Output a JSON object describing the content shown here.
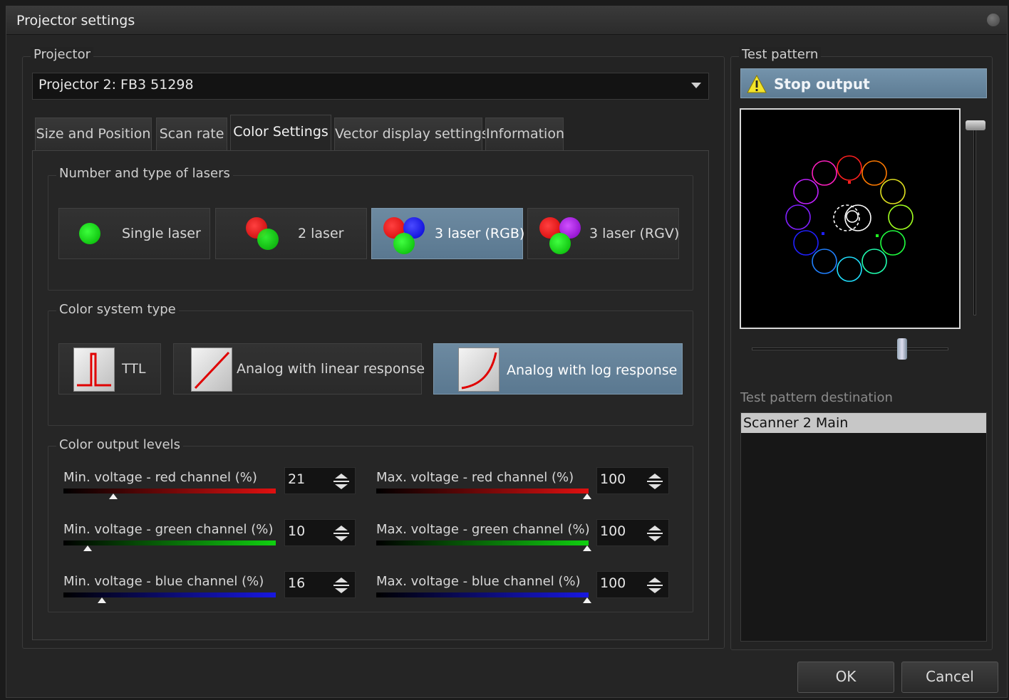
{
  "window": {
    "title": "Projector settings"
  },
  "projector": {
    "group_label": "Projector",
    "selected": "Projector 2: FB3 51298"
  },
  "tabs": [
    {
      "label": "Size and Position"
    },
    {
      "label": "Scan rate"
    },
    {
      "label": "Color Settings"
    },
    {
      "label": "Vector display settings"
    },
    {
      "label": "Information"
    }
  ],
  "active_tab": "Color Settings",
  "lasers": {
    "group_label": "Number and type of lasers",
    "options": [
      {
        "label": "Single laser"
      },
      {
        "label": "2 laser"
      },
      {
        "label": "3 laser (RGB)"
      },
      {
        "label": "3 laser (RGV)"
      }
    ],
    "selected": "3 laser (RGB)"
  },
  "color_system": {
    "group_label": "Color system type",
    "options": [
      {
        "label": "TTL"
      },
      {
        "label": "Analog with linear response"
      },
      {
        "label": "Analog with log response"
      }
    ],
    "selected": "Analog with log response"
  },
  "levels": {
    "group_label": "Color output levels",
    "min": [
      {
        "label": "Min. voltage - red channel (%)",
        "value": "21",
        "color": "#e01010"
      },
      {
        "label": "Min. voltage - green channel (%)",
        "value": "10",
        "color": "#10d010"
      },
      {
        "label": "Min. voltage - blue channel (%)",
        "value": "16",
        "color": "#1818e0"
      }
    ],
    "max": [
      {
        "label": "Max. voltage - red channel (%)",
        "value": "100",
        "color": "#e01010"
      },
      {
        "label": "Max. voltage - green channel (%)",
        "value": "100",
        "color": "#10d010"
      },
      {
        "label": "Max. voltage - blue channel (%)",
        "value": "100",
        "color": "#1818e0"
      }
    ]
  },
  "test_pattern": {
    "group_label": "Test pattern",
    "stop_label": "Stop output",
    "destination_label": "Test pattern destination",
    "destinations": [
      "Scanner 2 Main"
    ]
  },
  "footer": {
    "ok_label": "OK",
    "cancel_label": "Cancel"
  },
  "colors": {
    "accent": "#6283a0",
    "background": "#252525"
  }
}
